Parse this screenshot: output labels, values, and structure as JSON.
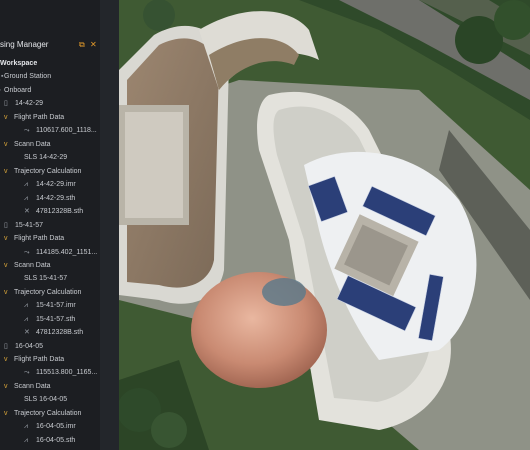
{
  "panel": {
    "title": "sing Manager",
    "workspace": "Workspace",
    "ground_station": "Ground Station",
    "onboard": "Onboard",
    "missions": [
      {
        "name": "14-42-29",
        "flight_path_label": "Flight Path Data",
        "flight_path_file": "110617.600_1118...",
        "scann_label": "Scann Data",
        "scann_file": "SLS 14-42-29",
        "traj_label": "Trajectory Calculation",
        "traj_files": [
          "14-42-29.imr",
          "14-42-29.sth",
          "47812328B.sth"
        ]
      },
      {
        "name": "15-41-57",
        "flight_path_label": "Flight Path Data",
        "flight_path_file": "114185.402_1151...",
        "scann_label": "Scann Data",
        "scann_file": "SLS 15-41-57",
        "traj_label": "Trajectory Calculation",
        "traj_files": [
          "15-41-57.imr",
          "15-41-57.sth",
          "47812328B.sth"
        ]
      },
      {
        "name": "16-04-05",
        "flight_path_label": "Flight Path Data",
        "flight_path_file": "115513.800_1165...",
        "scann_label": "Scann Data",
        "scann_file": "SLS 16-04-05",
        "traj_label": "Trajectory Calculation",
        "traj_files": [
          "16-04-05.imr",
          "16-04-05.sth"
        ]
      }
    ]
  },
  "colors": {
    "accent": "#e59b2a",
    "panel_bg": "#1c1e22",
    "text": "#c9ccd1"
  },
  "icons": {
    "float": "float-window-icon",
    "close": "close-icon"
  }
}
